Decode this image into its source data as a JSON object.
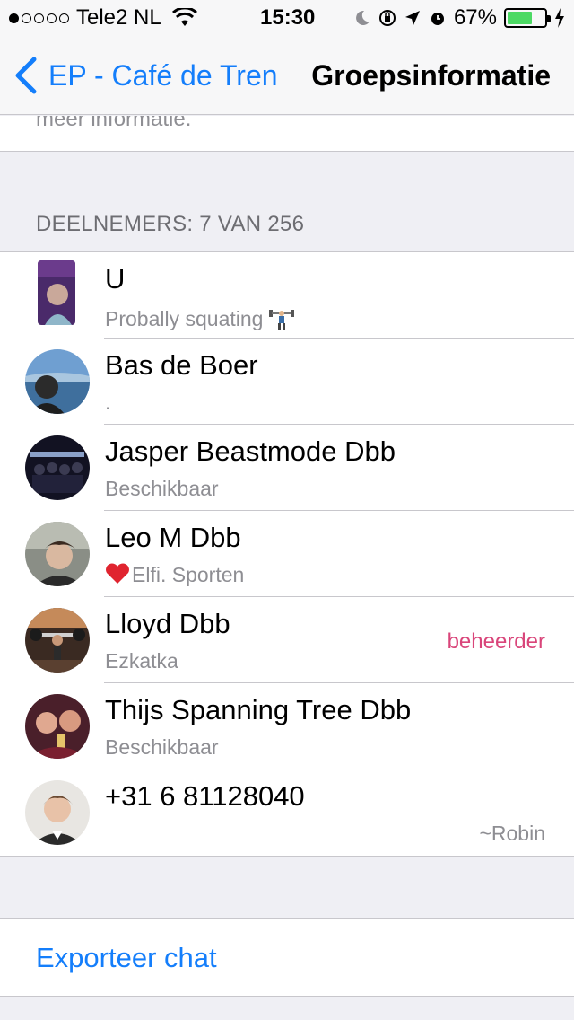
{
  "status_bar": {
    "carrier": "Tele2 NL",
    "time": "15:30",
    "battery": "67%",
    "battery_level": 0.67
  },
  "nav": {
    "back_label": "EP - Café de Tren",
    "title": "Groepsinformatie"
  },
  "info_fragment": "meer informatie.",
  "participants_header": "DEELNEMERS: 7 VAN 256",
  "participants": [
    {
      "name": "U",
      "status": "Probally squating",
      "role": "",
      "alias": ""
    },
    {
      "name": "Bas de Boer",
      "status": ".",
      "role": "",
      "alias": ""
    },
    {
      "name": "Jasper Beastmode Dbb",
      "status": "Beschikbaar",
      "role": "",
      "alias": ""
    },
    {
      "name": "Leo M Dbb",
      "status": "Elfi. Sporten",
      "role": "",
      "alias": ""
    },
    {
      "name": "Lloyd Dbb",
      "status": "Ezkatka",
      "role": "beheerder",
      "alias": ""
    },
    {
      "name": "Thijs Spanning Tree Dbb",
      "status": "Beschikbaar",
      "role": "",
      "alias": ""
    },
    {
      "name": "+31 6 81128040",
      "status": "",
      "role": "",
      "alias": "~Robin"
    }
  ],
  "export_label": "Exporteer chat",
  "colors": {
    "accent": "#147efb",
    "admin": "#d9457a",
    "battery": "#4cd964",
    "secondary_text": "#8e8e93"
  }
}
